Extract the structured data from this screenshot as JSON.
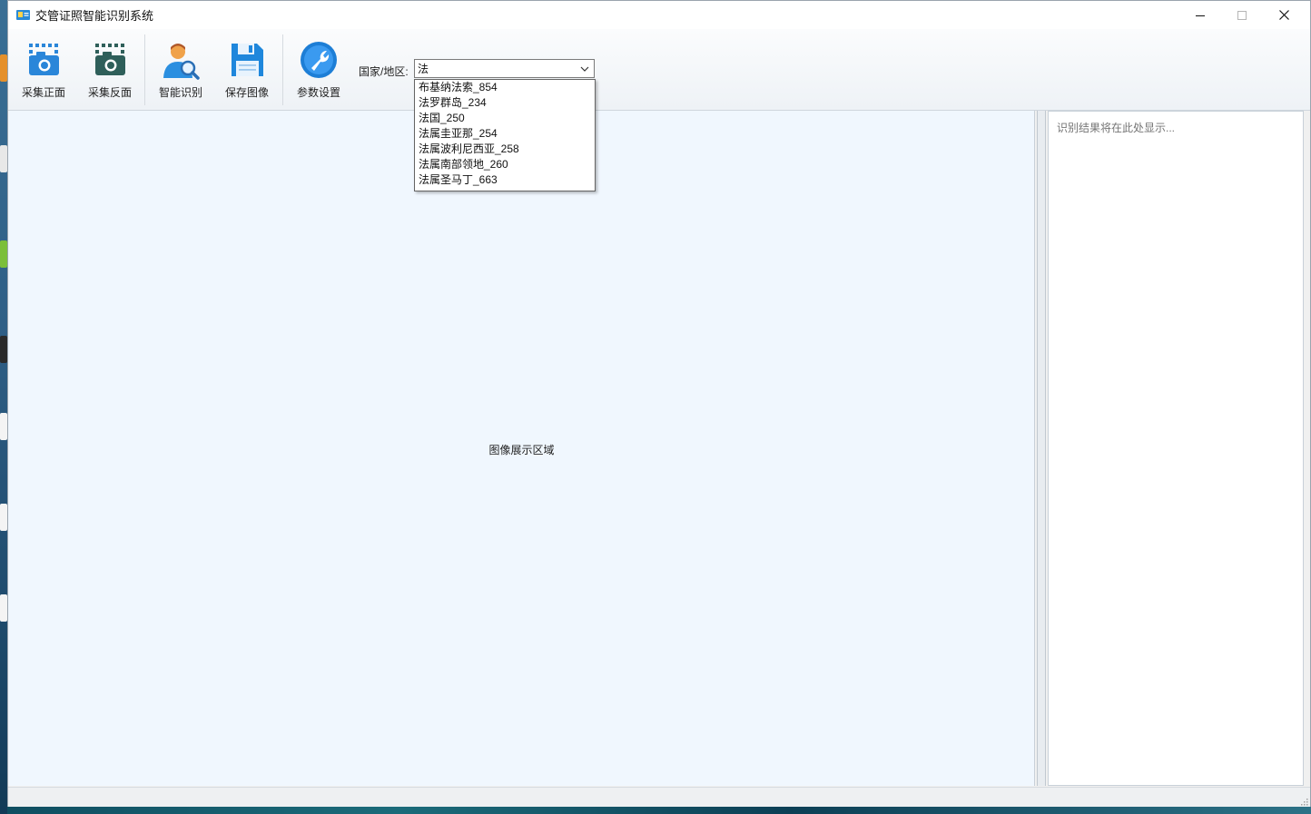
{
  "window": {
    "title": "交管证照智能识别系统"
  },
  "toolbar": {
    "buttons": [
      {
        "label": "采集正面",
        "icon": "camera-front-icon"
      },
      {
        "label": "采集反面",
        "icon": "camera-back-icon"
      },
      {
        "label": "智能识别",
        "icon": "person-search-icon"
      },
      {
        "label": "保存图像",
        "icon": "floppy-save-icon"
      },
      {
        "label": "参数设置",
        "icon": "wrench-settings-icon"
      }
    ]
  },
  "region": {
    "label": "国家/地区:",
    "value": "法",
    "options": [
      "布基纳法索_854",
      "法罗群岛_234",
      "法国_250",
      "法属圭亚那_254",
      "法属波利尼西亚_258",
      "法属南部领地_260",
      "法属圣马丁_663"
    ]
  },
  "image_area": {
    "placeholder": "图像展示区域",
    "background": "#f0f7fe"
  },
  "result": {
    "placeholder": "识别结果将在此处显示..."
  },
  "colors": {
    "accent": "#1e7fd8",
    "camera_back": "#2f5f5a",
    "person": "#e8913a"
  }
}
